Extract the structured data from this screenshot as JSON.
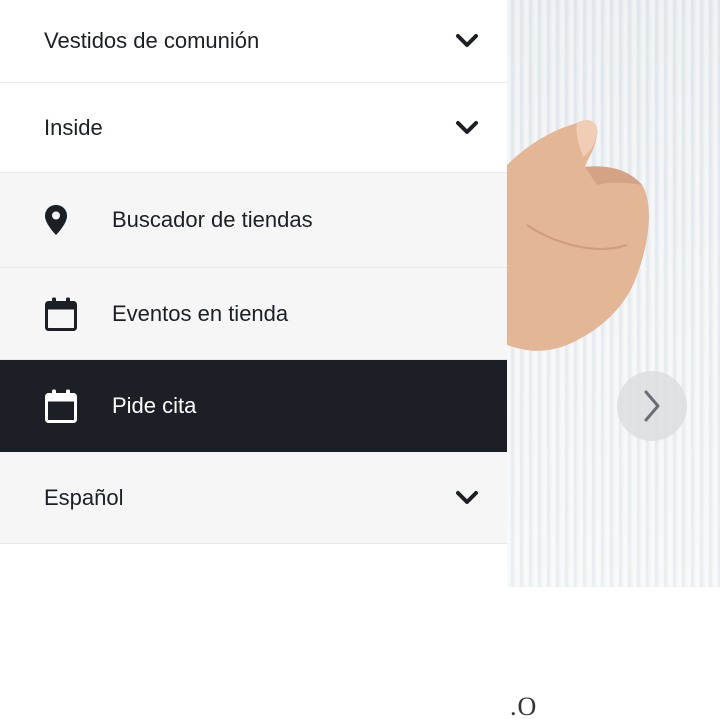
{
  "menu": {
    "items": [
      {
        "label": "Vestidos de comunión",
        "type": "collapsible"
      },
      {
        "label": "Inside",
        "type": "collapsible",
        "expanded": true
      }
    ],
    "sub_items": [
      {
        "label": "Buscador de tiendas",
        "icon": "map-pin-icon"
      },
      {
        "label": "Eventos en tienda",
        "icon": "calendar-icon"
      },
      {
        "label": "Pide cita",
        "icon": "calendar-icon",
        "active": true
      }
    ],
    "language": {
      "label": "Español"
    }
  },
  "background": {
    "partial_text": ".O",
    "carousel_next_icon": "chevron-right-icon"
  },
  "colors": {
    "active_bg": "#1c2026",
    "sub_bg": "#f6f6f6",
    "text": "#1c1f24"
  }
}
